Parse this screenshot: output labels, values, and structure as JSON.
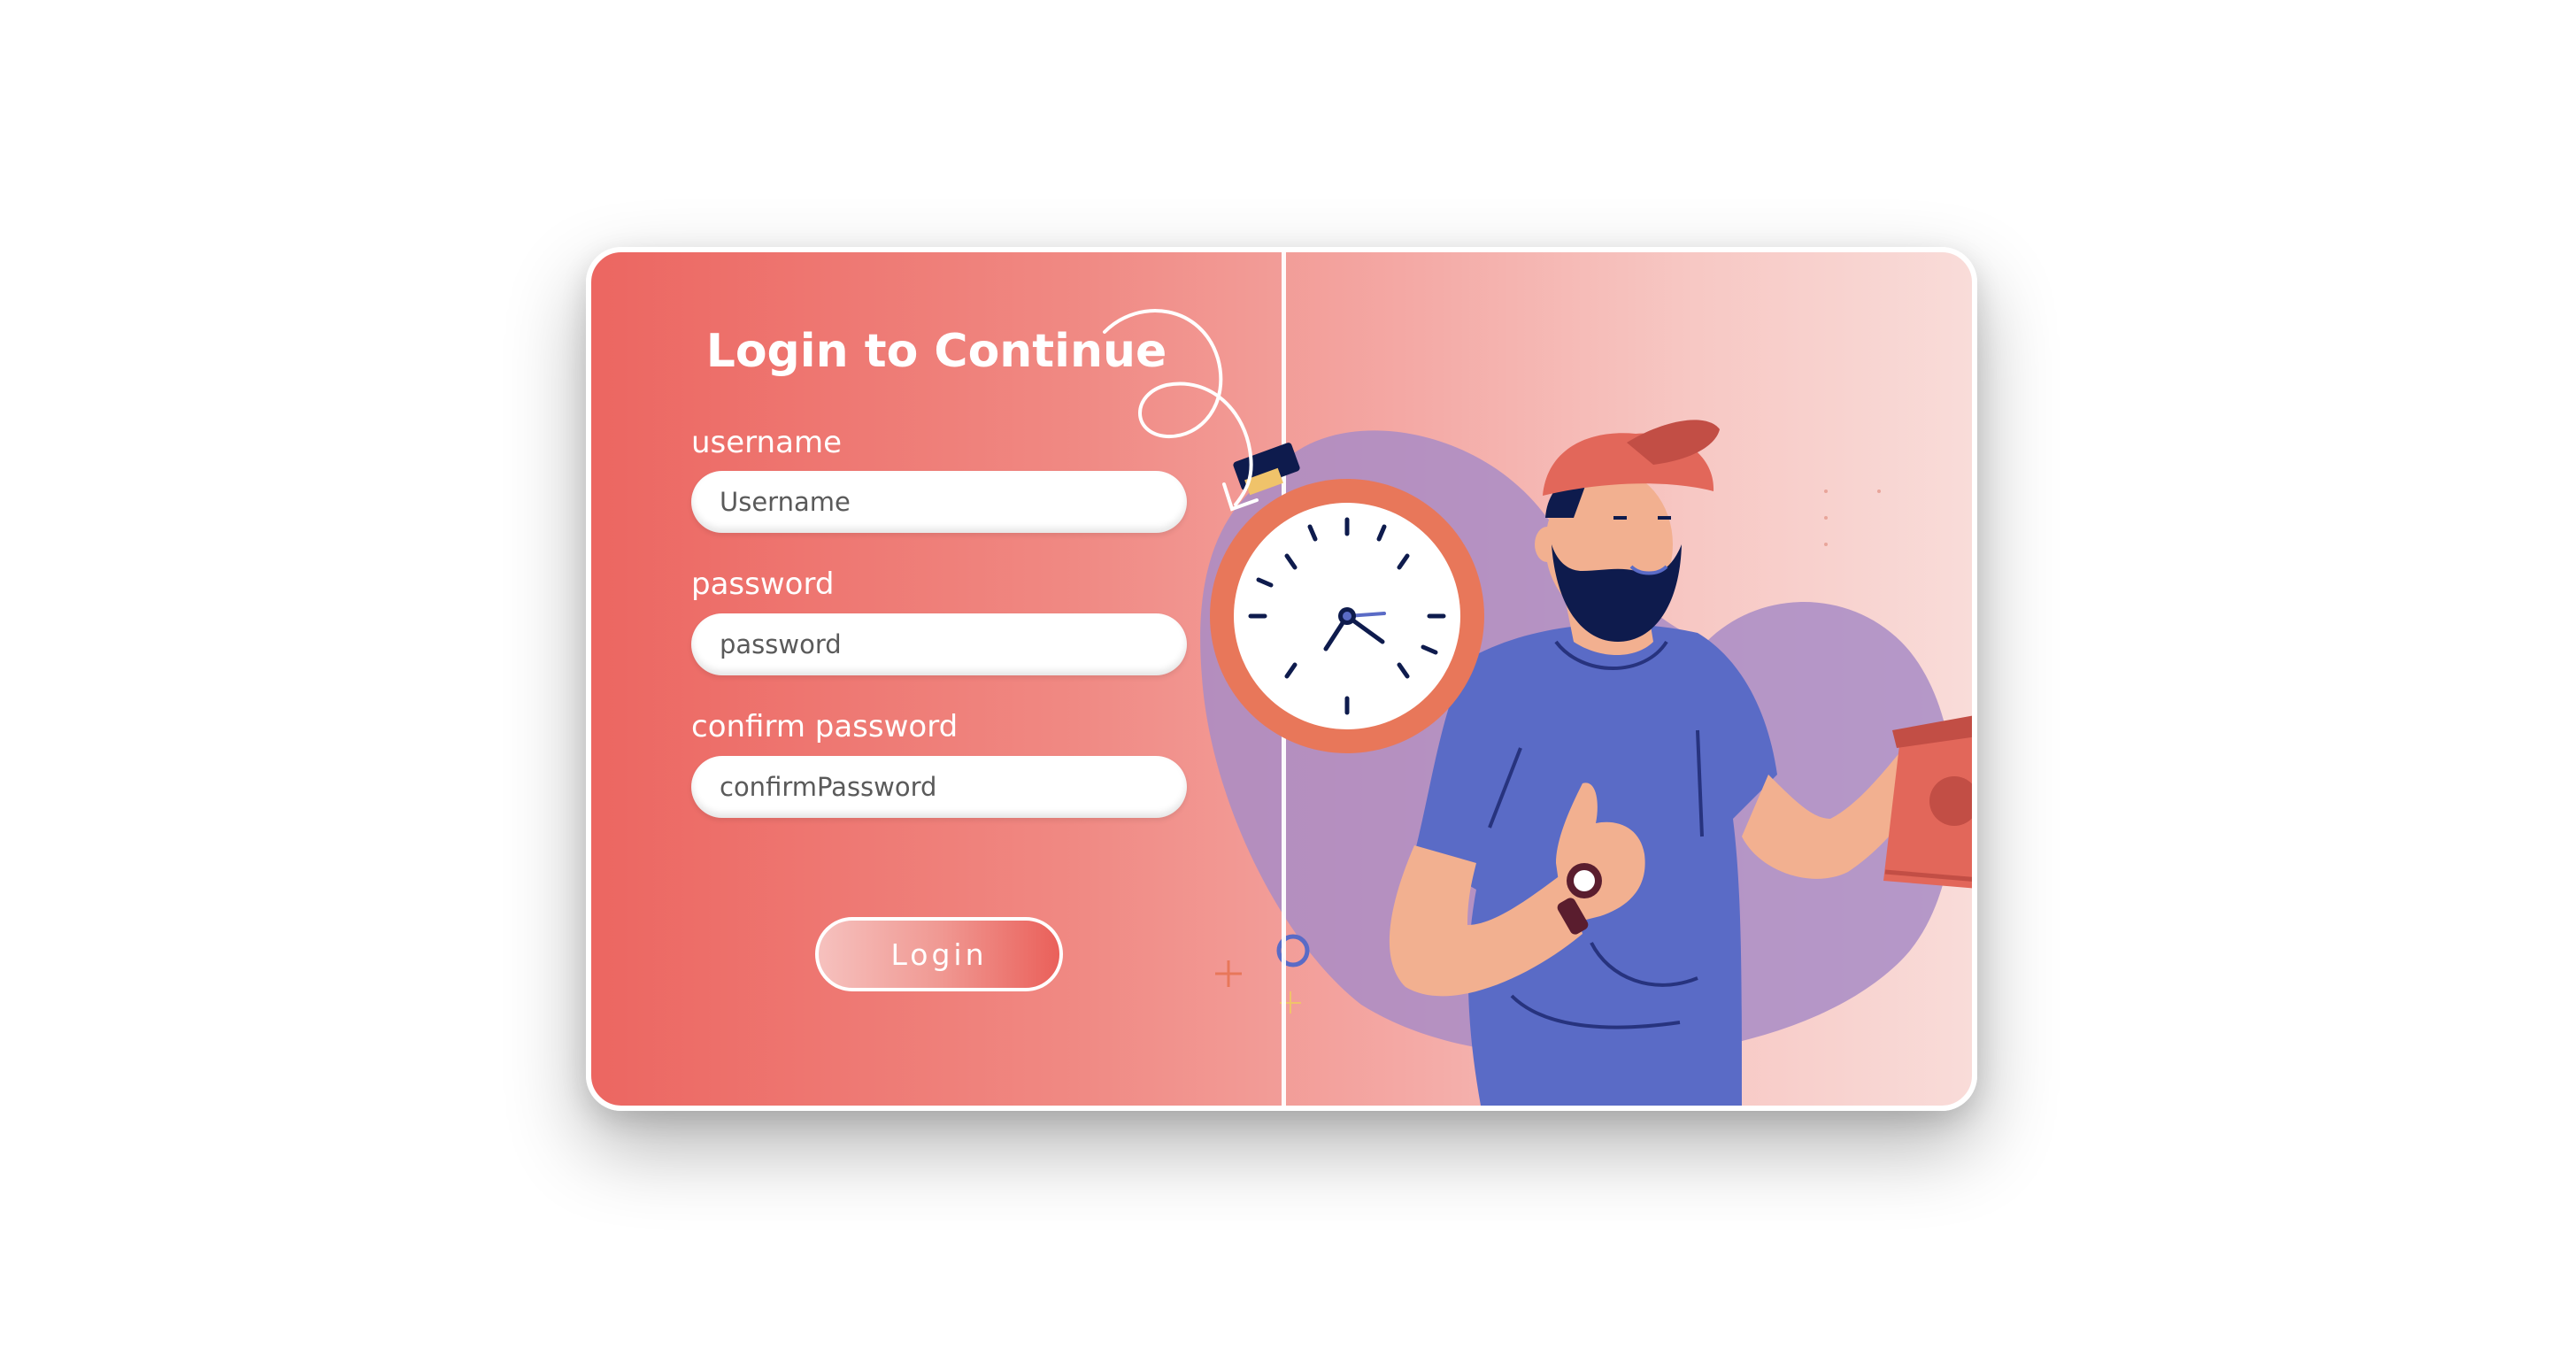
{
  "form": {
    "title": "Login to Continue",
    "fields": [
      {
        "label": "username",
        "placeholder": "Username"
      },
      {
        "label": "password",
        "placeholder": "password"
      },
      {
        "label": "confirm password",
        "placeholder": "confirmPassword"
      }
    ],
    "login_label": "Login"
  },
  "colors": {
    "panel_gradient_start": "#ec6661",
    "panel_gradient_end": "#f9dcd9",
    "blob": "#a98cc6",
    "clock_ring": "#e8775a",
    "shirt": "#5a6bc6",
    "cap": "#e2675a",
    "skin": "#f2b090",
    "hair": "#0e1b4d"
  },
  "illustration": {
    "subject": "delivery-man-illustration",
    "icons": [
      "stopwatch-icon",
      "swirl-arrow-icon",
      "package-icon",
      "wristwatch-icon",
      "sparkle-icon",
      "ring-icon"
    ]
  }
}
